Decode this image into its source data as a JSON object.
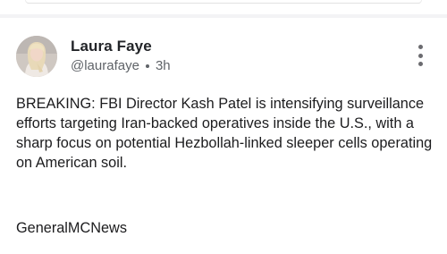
{
  "post": {
    "author_name": "Laura Faye",
    "handle": "@laurafaye",
    "timestamp": "3h",
    "body": "BREAKING: FBI Director Kash Patel is intensifying surveillance efforts targeting Iran-backed operatives inside the U.S., with a sharp focus on potential Hezbollah-linked sleeper cells operating on American soil.",
    "signature": "GeneralMCNews"
  },
  "icons": {
    "avatar": "profile-photo",
    "more": "vertical-ellipsis-icon"
  }
}
